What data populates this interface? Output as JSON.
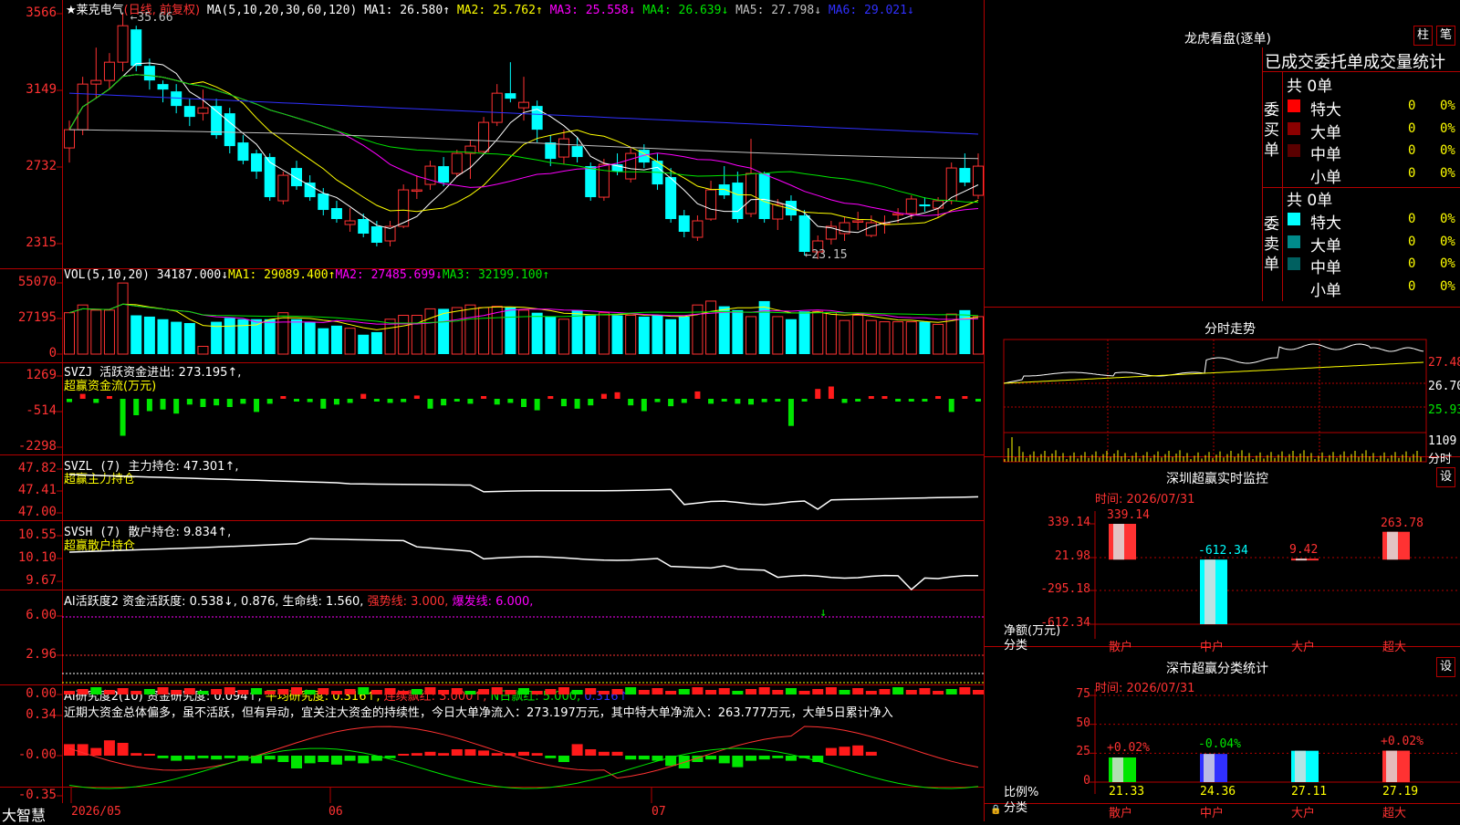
{
  "main": {
    "title": "★莱克电气",
    "period": "(日线, 前复权)",
    "ma_label": "MA(5,10,20,30,60,120)",
    "ma": [
      {
        "label": "MA1: 26.580↑",
        "color": "#ffffff"
      },
      {
        "label": "MA2: 25.762↑",
        "color": "#ffff00"
      },
      {
        "label": "MA3: 25.558↓",
        "color": "#ff00ff"
      },
      {
        "label": "MA4: 26.639↓",
        "color": "#00e600"
      },
      {
        "label": "MA5: 27.798↓",
        "color": "#c0c0c0"
      },
      {
        "label": "MA6: 29.021↓",
        "color": "#3030ff"
      }
    ],
    "yticks": [
      "3566",
      "3149",
      "2732",
      "2315"
    ],
    "high_marker": "35.66",
    "low_marker": "23.15"
  },
  "vol": {
    "label": "VOL(5,10,20)",
    "value": "34187.000↓",
    "ma1": "MA1: 29089.400↑",
    "ma2": "MA2: 27485.699↓",
    "ma3": "MA3: 32199.100↑",
    "yticks": [
      "55070",
      "27195",
      "0"
    ]
  },
  "svzj": {
    "label": "SVZJ",
    "text": "活跃资金进出: 273.195↑,",
    "sub": "超赢资金流(万元)",
    "yticks": [
      "1269",
      "-514",
      "-2298"
    ]
  },
  "svzl": {
    "label": "SVZL (7)",
    "text": "主力持仓: 47.301↑,",
    "sub": "超赢主力持仓",
    "yticks": [
      "47.82",
      "47.41",
      "47.00"
    ]
  },
  "svsh": {
    "label": "SVSH (7)",
    "text": "散户持仓: 9.834↑,",
    "sub": "超赢散户持仓",
    "yticks": [
      "10.55",
      "10.10",
      "9.67"
    ]
  },
  "ai1": {
    "label": "AI活跃度2",
    "t1": "资金活跃度: 0.538↓,",
    "t2": "0.876,",
    "t3": "生命线: 1.560,",
    "t4": "强势线: 3.000,",
    "t5": "爆发线: 6.000,",
    "yticks": [
      "6.00",
      "2.96",
      "0.00"
    ]
  },
  "ai2": {
    "label": "AI研究度2(10)",
    "t1": "资金研究度: 0.094↑,",
    "t2": "平均研究度: 0.316↑,",
    "t3": "连续飘红: 3.000↑,",
    "t4": "N日飘红: 5.000,",
    "t5": "0.316↑",
    "comment": "近期大资金总体偏多，虽不活跃，但有异动，宜关注大资金的持续性，今日大单净流入：273.197万元，其中特大单净流入：263.777万元，大单5日累计净入",
    "yticks": [
      "0.34",
      "-0.00",
      "-0.35"
    ]
  },
  "footer": {
    "brand": "大智慧",
    "dates": [
      "2026/05",
      "06",
      "07"
    ]
  },
  "lhb": {
    "title": "龙虎看盘(逐单)",
    "btn1": "柱",
    "btn2": "笔",
    "header": "已成交委托单成交量统计",
    "buy_label": "委买单",
    "sell_label": "委卖单",
    "buy_total": "共 0单",
    "sell_total": "共 0单",
    "buy_rows": [
      {
        "name": "特大",
        "count": "0",
        "pct": "0%",
        "color": "#ff0000"
      },
      {
        "name": "大单",
        "count": "0",
        "pct": "0%",
        "color": "#8b0000"
      },
      {
        "name": "中单",
        "count": "0",
        "pct": "0%",
        "color": "#5a0000"
      },
      {
        "name": "小单",
        "count": "0",
        "pct": "0%",
        "color": "#000000"
      }
    ],
    "sell_rows": [
      {
        "name": "特大",
        "count": "0",
        "pct": "0%",
        "color": "#00ffff"
      },
      {
        "name": "大单",
        "count": "0",
        "pct": "0%",
        "color": "#008b8b"
      },
      {
        "name": "中单",
        "count": "0",
        "pct": "0%",
        "color": "#006060"
      },
      {
        "name": "小单",
        "count": "0",
        "pct": "0%",
        "color": "#000000"
      }
    ]
  },
  "intraday": {
    "title": "分时走势",
    "yticks": [
      "27.48",
      "26.70",
      "25.93"
    ],
    "vol_tick": "1109",
    "vol_label": "分时"
  },
  "monitor": {
    "title": "深圳超赢实时监控",
    "btn": "设",
    "time": "时间: 2026/07/31",
    "yticks": [
      "339.14",
      "21.98",
      "-295.18",
      "-612.34"
    ],
    "ylabel": "净额(万元)",
    "xlabel": "分类",
    "bars": [
      {
        "cat": "散户",
        "value": 339.14,
        "label": "339.14"
      },
      {
        "cat": "中户",
        "value": -612.34,
        "label": "-612.34"
      },
      {
        "cat": "大户",
        "value": 9.42,
        "label": "9.42"
      },
      {
        "cat": "超大",
        "value": 263.78,
        "label": "263.78"
      }
    ]
  },
  "stats": {
    "title": "深市超赢分类统计",
    "btn": "设",
    "time": "时间: 2026/07/31",
    "yticks": [
      "75",
      "50",
      "25",
      "0"
    ],
    "ylabel": "比例%",
    "xlabel": "分类",
    "bars": [
      {
        "cat": "散户",
        "value": 21.33,
        "label": "21.33",
        "delta": "+0.02%",
        "delta_color": "#ff3232",
        "color": "#00e600"
      },
      {
        "cat": "中户",
        "value": 24.36,
        "label": "24.36",
        "delta": "-0.04%",
        "delta_color": "#00e600",
        "color": "#3030ff"
      },
      {
        "cat": "大户",
        "value": 27.11,
        "label": "27.11",
        "delta": "",
        "delta_color": "#ffffff",
        "color": "#00ffff"
      },
      {
        "cat": "超大",
        "value": 27.19,
        "label": "27.19",
        "delta": "+0.02%",
        "delta_color": "#ff3232",
        "color": "#ff3232"
      }
    ]
  },
  "chart_data": {
    "type": "candlestick",
    "candles": [
      [
        28.3,
        29.3,
        29.8,
        27.5
      ],
      [
        29.3,
        31.8,
        32.2,
        29.0
      ],
      [
        31.8,
        32.0,
        33.8,
        31.0
      ],
      [
        32.0,
        33.0,
        33.5,
        31.5
      ],
      [
        33.0,
        35.0,
        35.66,
        32.5
      ],
      [
        34.8,
        32.8,
        35.0,
        32.5
      ],
      [
        32.8,
        32.0,
        33.2,
        31.5
      ],
      [
        31.8,
        31.5,
        32.0,
        30.8
      ],
      [
        31.4,
        30.6,
        31.8,
        30.2
      ],
      [
        30.6,
        30.0,
        31.0,
        29.5
      ],
      [
        30.2,
        30.5,
        31.5,
        29.8
      ],
      [
        30.6,
        29.0,
        31.0,
        28.8
      ],
      [
        30.2,
        28.4,
        30.5,
        28.0
      ],
      [
        28.6,
        27.6,
        29.0,
        27.4
      ],
      [
        28.0,
        27.0,
        28.2,
        26.6
      ],
      [
        27.8,
        25.6,
        28.0,
        25.4
      ],
      [
        25.4,
        26.8,
        27.0,
        25.2
      ],
      [
        27.2,
        26.2,
        27.6,
        26.0
      ],
      [
        26.4,
        25.6,
        26.8,
        25.4
      ],
      [
        25.8,
        24.9,
        26.1,
        24.6
      ],
      [
        25.0,
        24.4,
        25.4,
        24.2
      ],
      [
        24.1,
        24.3,
        25.0,
        23.7
      ],
      [
        24.4,
        23.6,
        24.7,
        23.4
      ],
      [
        24.0,
        23.1,
        24.3,
        22.9
      ],
      [
        23.2,
        24.0,
        24.3,
        22.9
      ],
      [
        24.0,
        26.0,
        26.3,
        23.9
      ],
      [
        26.0,
        26.0,
        26.8,
        25.5
      ],
      [
        26.3,
        27.3,
        27.6,
        26.0
      ],
      [
        27.3,
        26.4,
        27.8,
        26.2
      ],
      [
        26.9,
        28.0,
        28.2,
        26.7
      ],
      [
        28.0,
        28.4,
        28.7,
        26.6
      ],
      [
        28.1,
        29.7,
        30.0,
        28.0
      ],
      [
        29.7,
        31.3,
        31.8,
        29.5
      ],
      [
        31.3,
        31.0,
        33.0,
        30.8
      ],
      [
        30.5,
        30.8,
        32.2,
        29.8
      ],
      [
        30.6,
        29.3,
        30.9,
        28.6
      ],
      [
        28.6,
        27.7,
        29.0,
        27.3
      ],
      [
        27.8,
        28.8,
        29.3,
        27.4
      ],
      [
        28.4,
        27.8,
        28.9,
        27.5
      ],
      [
        27.3,
        25.6,
        27.5,
        25.4
      ],
      [
        25.6,
        27.4,
        27.7,
        25.4
      ],
      [
        27.4,
        27.0,
        28.0,
        26.8
      ],
      [
        26.6,
        28.0,
        28.3,
        26.4
      ],
      [
        28.2,
        27.5,
        28.5,
        27.2
      ],
      [
        27.6,
        26.3,
        28.0,
        26.0
      ],
      [
        26.7,
        24.4,
        27.2,
        24.2
      ],
      [
        24.6,
        23.7,
        24.9,
        23.4
      ],
      [
        23.4,
        24.3,
        24.6,
        23.2
      ],
      [
        24.4,
        26.0,
        26.5,
        24.3
      ],
      [
        26.3,
        25.7,
        27.3,
        25.5
      ],
      [
        26.4,
        24.4,
        27.0,
        24.2
      ],
      [
        24.7,
        26.9,
        28.8,
        24.5
      ],
      [
        26.9,
        24.4,
        27.0,
        24.2
      ],
      [
        24.4,
        25.2,
        25.5,
        23.8
      ],
      [
        25.4,
        24.6,
        25.7,
        24.3
      ],
      [
        24.6,
        22.6,
        24.9,
        22.4
      ],
      [
        22.6,
        23.2,
        23.5,
        22.2
      ],
      [
        23.3,
        24.0,
        24.3,
        23.0
      ],
      [
        23.6,
        24.2,
        24.5,
        23.2
      ],
      [
        24.3,
        24.3,
        24.8,
        23.8
      ],
      [
        23.5,
        24.2,
        24.6,
        23.4
      ],
      [
        24.2,
        24.2,
        24.6,
        23.6
      ],
      [
        24.7,
        24.7,
        25.0,
        24.2
      ],
      [
        24.7,
        25.5,
        25.7,
        24.4
      ],
      [
        25.2,
        25.1,
        25.6,
        24.8
      ],
      [
        25.0,
        25.4,
        25.6,
        24.5
      ],
      [
        25.4,
        27.2,
        27.5,
        25.2
      ],
      [
        27.2,
        26.4,
        28.0,
        26.2
      ],
      [
        25.7,
        27.3,
        28.0,
        25.5
      ]
    ],
    "volume": [
      32000,
      38000,
      34000,
      34000,
      55000,
      30000,
      29000,
      27000,
      25000,
      24000,
      6000,
      25000,
      28000,
      27000,
      27000,
      27000,
      32000,
      27000,
      25000,
      20000,
      22000,
      20000,
      15000,
      17000,
      27000,
      30000,
      30000,
      35000,
      35000,
      36000,
      38000,
      36000,
      37000,
      36000,
      34000,
      32000,
      29000,
      27000,
      34000,
      30000,
      32000,
      30000,
      30000,
      29000,
      30000,
      27000,
      29000,
      38000,
      41000,
      37000,
      34000,
      29000,
      41000,
      29000,
      27000,
      33000,
      33000,
      32000,
      26000,
      30000,
      26000,
      25000,
      25000,
      25000,
      25000,
      23000,
      31000,
      34000,
      29000
    ],
    "xlabels": [
      "2026/05",
      "06",
      "07"
    ]
  }
}
